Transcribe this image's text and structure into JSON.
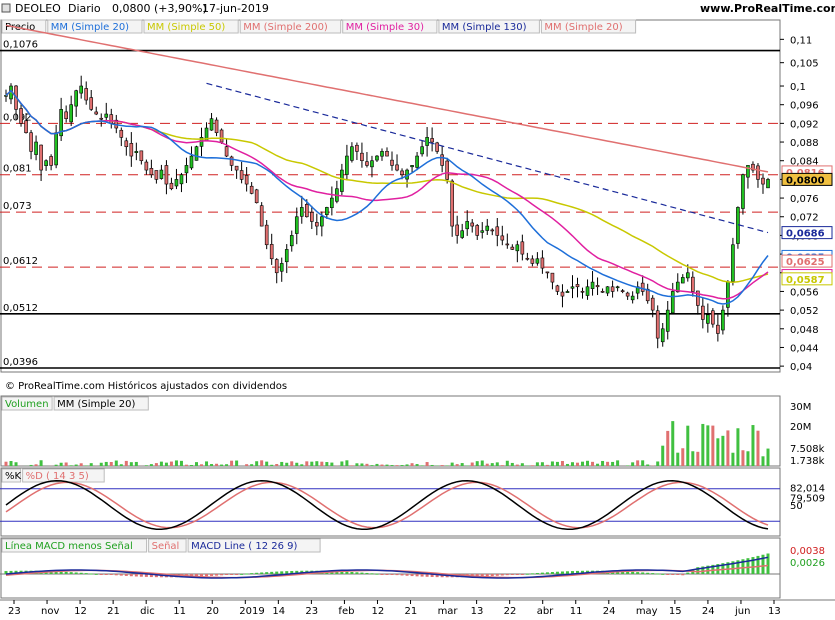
{
  "header": {
    "ticker": "DEOLEO",
    "period": "Diario",
    "price_change": "0,0800 (+3,90%)",
    "date": "17-jun-2019",
    "site": "www.ProRealTime.com"
  },
  "price_panel": {
    "legend": [
      {
        "text": "Precio",
        "color": "#000000"
      },
      {
        "text": "MM (Simple 20)",
        "color": "#1e6fd9"
      },
      {
        "text": "MM (Simple 50)",
        "color": "#c8c800"
      },
      {
        "text": "MM (Simple 200)",
        "color": "#e07070"
      },
      {
        "text": "MM (Simple 30)",
        "color": "#e020a0"
      },
      {
        "text": "MM (Simple 130)",
        "color": "#1a2a9a"
      },
      {
        "text": "MM (Simple 20)",
        "color": "#e07070"
      }
    ],
    "level_labels": [
      "0,1076",
      "0,092",
      "0,081",
      "0,073",
      "0,0612",
      "0,0512",
      "0,0396"
    ],
    "copyright": "© ProRealTime.com  Históricos ajustados con dividendos"
  },
  "volume_panel": {
    "legend": [
      {
        "text": "Volumen",
        "color": "#20a020"
      },
      {
        "text": "MM (Simple 20)",
        "color": "#000000"
      }
    ],
    "axis_labels": [
      "30M",
      "20M",
      "7.508k",
      "1.738k"
    ]
  },
  "stoch_panel": {
    "legend": [
      {
        "text": "%K",
        "color": "#000000"
      },
      {
        "text": "%D ( 14 3 5)",
        "color": "#e07070"
      }
    ],
    "axis_labels": [
      "82,014",
      "79,509",
      "50"
    ]
  },
  "macd_panel": {
    "legend": [
      {
        "text": "Línea MACD menos Señal",
        "color": "#20a020"
      },
      {
        "text": "Señal",
        "color": "#e07070"
      },
      {
        "text": "MACD Line ( 12 26 9)",
        "color": "#1a2a9a"
      }
    ],
    "axis_labels": [
      "0,0038",
      "0,0026"
    ]
  },
  "x_axis": {
    "labels": [
      "23",
      "nov",
      "12",
      "21",
      "dic",
      "11",
      "20",
      "2019",
      "14",
      "23",
      "feb",
      "12",
      "21",
      "mar",
      "13",
      "22",
      "abr",
      "11",
      "24",
      "may",
      "15",
      "24",
      "jun",
      "13"
    ]
  },
  "chart_data": {
    "type": "candlestick",
    "title": "DEOLEO Diario",
    "ylim": [
      0.0396,
      0.112
    ],
    "y_ticks": [
      0.04,
      0.044,
      0.048,
      0.052,
      0.056,
      0.06,
      0.064,
      0.068,
      0.072,
      0.076,
      0.08,
      0.084,
      0.088,
      0.092,
      0.096,
      0.1,
      0.105,
      0.11
    ],
    "y_tick_labels": [
      "0,04",
      "0,044",
      "0,048",
      "0,052",
      "0,056",
      "0,06",
      "0,064",
      "0,068",
      "0,072",
      "0,076",
      "0,08",
      "0,084",
      "0,088",
      "0,092",
      "0,096",
      "0,1",
      "0,105",
      "0,11"
    ],
    "horizontal_levels": {
      "solid": [
        0.1076,
        0.0512,
        0.0396
      ],
      "dashed": [
        0.092,
        0.081,
        0.073,
        0.0612
      ]
    },
    "last_values": [
      {
        "value": 0.0816,
        "label": "0,0816",
        "color": "#e07070"
      },
      {
        "value": 0.08,
        "label": "0,0800",
        "color": "#000000"
      },
      {
        "value": 0.0686,
        "label": "0,0686",
        "color": "#1a2a9a"
      },
      {
        "value": 0.0635,
        "label": "0,0635",
        "color": "#1e6fd9"
      },
      {
        "value": 0.0625,
        "label": "0,0625",
        "color": "#e07070"
      },
      {
        "value": 0.0594,
        "label": "0,0594",
        "color": "#e020a0"
      },
      {
        "value": 0.0587,
        "label": "0,0587",
        "color": "#c8c800"
      }
    ],
    "close": [
      0.098,
      0.1,
      0.095,
      0.092,
      0.09,
      0.086,
      0.088,
      0.082,
      0.084,
      0.083,
      0.09,
      0.095,
      0.093,
      0.096,
      0.099,
      0.1,
      0.097,
      0.095,
      0.094,
      0.093,
      0.094,
      0.092,
      0.091,
      0.089,
      0.087,
      0.085,
      0.086,
      0.084,
      0.082,
      0.081,
      0.08,
      0.082,
      0.079,
      0.078,
      0.08,
      0.081,
      0.083,
      0.085,
      0.087,
      0.089,
      0.091,
      0.093,
      0.09,
      0.088,
      0.085,
      0.083,
      0.082,
      0.08,
      0.079,
      0.077,
      0.075,
      0.07,
      0.066,
      0.063,
      0.06,
      0.062,
      0.065,
      0.068,
      0.072,
      0.074,
      0.072,
      0.071,
      0.07,
      0.072,
      0.074,
      0.076,
      0.078,
      0.082,
      0.085,
      0.087,
      0.086,
      0.084,
      0.083,
      0.084,
      0.085,
      0.086,
      0.085,
      0.083,
      0.082,
      0.081,
      0.082,
      0.083,
      0.085,
      0.087,
      0.089,
      0.088,
      0.086,
      0.083,
      0.08,
      0.07,
      0.068,
      0.069,
      0.071,
      0.07,
      0.068,
      0.069,
      0.07,
      0.069,
      0.068,
      0.067,
      0.066,
      0.065,
      0.066,
      0.064,
      0.063,
      0.062,
      0.063,
      0.061,
      0.06,
      0.058,
      0.056,
      0.055,
      0.056,
      0.057,
      0.057,
      0.056,
      0.057,
      0.058,
      0.057,
      0.056,
      0.057,
      0.056,
      0.057,
      0.056,
      0.055,
      0.055,
      0.057,
      0.056,
      0.054,
      0.052,
      0.046,
      0.048,
      0.052,
      0.056,
      0.058,
      0.059,
      0.06,
      0.056,
      0.053,
      0.05,
      0.051,
      0.049,
      0.047,
      0.052,
      0.058,
      0.066,
      0.074,
      0.081,
      0.083,
      0.082,
      0.08,
      0.079,
      0.08
    ]
  }
}
